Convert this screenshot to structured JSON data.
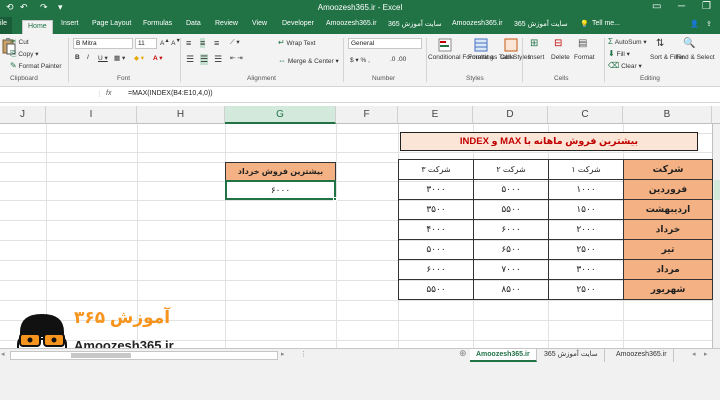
{
  "app": {
    "title": "Amoozesh365.ir - Excel"
  },
  "tabs": {
    "file": "ile",
    "home": "Home",
    "insert": "Insert",
    "page_layout": "Page Layout",
    "formulas": "Formulas",
    "data": "Data",
    "review": "Review",
    "view": "View",
    "developer": "Developer",
    "t1": "Amoozesh365.ir",
    "t2": "سایت آموزش 365",
    "t3": "Amoozesh365.ir",
    "t4": "سایت آموزش 365",
    "tell_me": "Tell me..."
  },
  "ribbon": {
    "cut": "Cut",
    "copy": "Copy",
    "format_painter": "Format Painter",
    "clipboard": "Clipboard",
    "font_name": "B Mitra",
    "font_size": "11",
    "font": "Font",
    "wrap_text": "Wrap Text",
    "merge_center": "Merge & Center",
    "alignment": "Alignment",
    "number_format": "General",
    "number": "Number",
    "conditional_formatting": "Conditional Formatting",
    "format_as_table": "Format as Table",
    "cell_styles": "Cell Styles",
    "styles": "Styles",
    "insert": "Insert",
    "delete": "Delete",
    "format": "Format",
    "cells": "Cells",
    "autosum": "AutoSum",
    "fill": "Fill",
    "clear": "Clear",
    "sort_filter": "Sort & Filter",
    "find_select": "Find & Select",
    "editing": "Editing"
  },
  "formula_bar": {
    "fx": "fx",
    "formula": "=MAX(INDEX(B4:E10,4,0))"
  },
  "columns": [
    "J",
    "I",
    "H",
    "G",
    "F",
    "E",
    "D",
    "C",
    "B"
  ],
  "banner": "بیشترین فروش ماهانه با MAX و INDEX",
  "table": {
    "header": [
      "شرکت ۳",
      "شرکت ۲",
      "شرکت ۱",
      "شرکت"
    ],
    "rows": [
      [
        "۳۰۰۰",
        "۵۰۰۰",
        "۱۰۰۰",
        "فروردین"
      ],
      [
        "۳۵۰۰",
        "۵۵۰۰",
        "۱۵۰۰",
        "اردیبهشت"
      ],
      [
        "۴۰۰۰",
        "۶۰۰۰",
        "۲۰۰۰",
        "خرداد"
      ],
      [
        "۵۰۰۰",
        "۶۵۰۰",
        "۲۵۰۰",
        "تیر"
      ],
      [
        "۶۰۰۰",
        "۷۰۰۰",
        "۳۰۰۰",
        "مرداد"
      ],
      [
        "۵۵۰۰",
        "۸۵۰۰",
        "۲۵۰۰",
        "شهریور"
      ]
    ]
  },
  "result": {
    "label": "بیشترین فروش خرداد",
    "value": "۶۰۰۰"
  },
  "logo": {
    "persian": "آموزش ۳۶۵",
    "english": "Amoozesh365.ir"
  },
  "sheets": [
    "Amoozesh365.ir",
    "سایت آموزش 365",
    "Amoozesh365.ir"
  ],
  "colors": {
    "excel_green": "#217346",
    "header_fill": "#f4b183",
    "banner_fill": "#fbe5d6",
    "banner_text": "#c00000",
    "logo_orange": "#f7941d"
  }
}
